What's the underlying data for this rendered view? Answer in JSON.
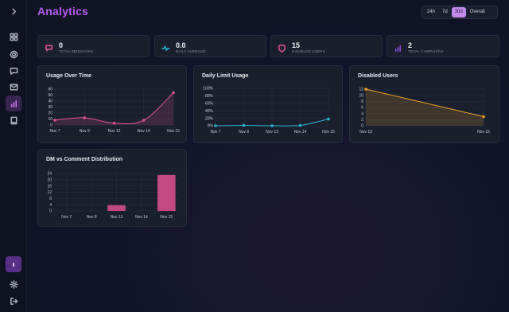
{
  "header": {
    "title": "Analytics"
  },
  "time_range": {
    "options": [
      "24h",
      "7d",
      "30d",
      "Overall"
    ],
    "selected": "30d"
  },
  "sidebar": {
    "items": [
      {
        "icon": "chevron-right-icon"
      },
      {
        "icon": "dashboard-grid-icon"
      },
      {
        "icon": "target-icon"
      },
      {
        "icon": "message-icon"
      },
      {
        "icon": "mail-icon"
      },
      {
        "icon": "analytics-icon",
        "active": true
      },
      {
        "icon": "book-icon"
      }
    ],
    "bottom": [
      {
        "icon": "avatar"
      },
      {
        "icon": "gear-icon"
      },
      {
        "icon": "logout-icon"
      }
    ]
  },
  "stats": [
    {
      "value": "0",
      "label": "TOTAL MESSAGES",
      "icon": "message-icon",
      "color": "#e0508f"
    },
    {
      "value": "0.0",
      "label": "DAILY AVERAGE",
      "icon": "pulse-icon",
      "color": "#23b3d8"
    },
    {
      "value": "15",
      "label": "DISABLED USERS",
      "icon": "shield-icon",
      "color": "#e0508f"
    },
    {
      "value": "2",
      "label": "TOTAL CAMPAIGNS",
      "icon": "bar-chart-icon",
      "color": "#8a4de0"
    }
  ],
  "colors": {
    "pink": "#e0508f",
    "cyan": "#23b3d8",
    "orange": "#f0a020",
    "purple": "#b45ef0"
  },
  "chart_data": [
    {
      "type": "area",
      "title": "Usage Over Time",
      "categories": [
        "Nov 7",
        "Nov 9",
        "Nov 13",
        "Nov 14",
        "Nov 15"
      ],
      "values": [
        8,
        12,
        3,
        8,
        54
      ],
      "yticks": [
        "0",
        "10",
        "20",
        "30",
        "40",
        "50",
        "60"
      ],
      "ylim": [
        0,
        60
      ],
      "grid": true,
      "color": "#e0508f"
    },
    {
      "type": "line",
      "title": "Daily Limit Usage",
      "categories": [
        "Nov 7",
        "Nov 9",
        "Nov 13",
        "Nov 14",
        "Nov 15"
      ],
      "values": [
        0,
        1,
        0,
        1,
        18
      ],
      "yticks": [
        "0%",
        "20%",
        "40%",
        "60%",
        "80%",
        "100%"
      ],
      "ylim": [
        0,
        100
      ],
      "grid": true,
      "color": "#23b3d8"
    },
    {
      "type": "area",
      "title": "Disabled Users",
      "categories": [
        "Nov 13",
        "Nov 15"
      ],
      "values": [
        12,
        3
      ],
      "yticks": [
        "0",
        "2",
        "4",
        "6",
        "8",
        "10",
        "12"
      ],
      "ylim": [
        0,
        12
      ],
      "grid": true,
      "color": "#f0a020"
    },
    {
      "type": "bar",
      "title": "DM vs Comment Distribution",
      "categories": [
        "Nov 7",
        "Nov 8",
        "Nov 13",
        "Nov 14",
        "Nov 15"
      ],
      "values": [
        0,
        0,
        4,
        0,
        25
      ],
      "yticks": [
        "0",
        "4",
        "8",
        "12",
        "16",
        "20",
        "24"
      ],
      "ylim": [
        0,
        26
      ],
      "grid": true,
      "color": "#e0508f"
    }
  ]
}
